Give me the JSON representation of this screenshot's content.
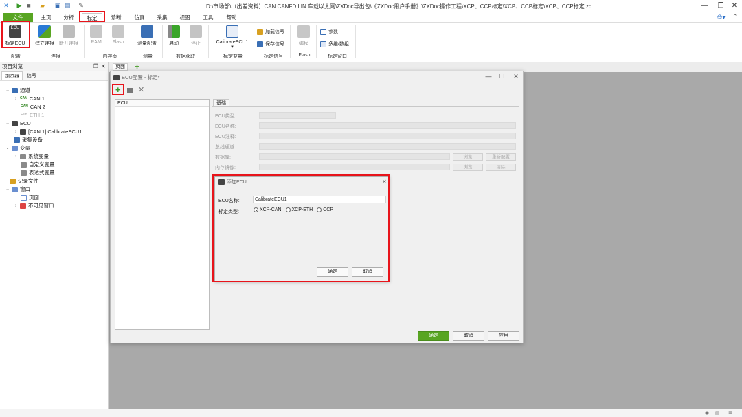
{
  "titlebar": {
    "path": "D:\\市场部\\（出差资料）CAN CANFD LIN 车载以太网\\ZXDoc导出包\\《ZXDoc用户手册》\\ZXDoc操作工程\\XCP、CCP标定\\XCP、CCP标定\\XCP、CCP标定.zcp* - ZXDoc"
  },
  "menu": {
    "items": [
      "文件",
      "主页",
      "分析",
      "标定",
      "诊断",
      "仿真",
      "采集",
      "视图",
      "工具",
      "帮助"
    ],
    "active": "标定"
  },
  "ribbon": {
    "groups": [
      "配置",
      "连接",
      "内存页",
      "测量",
      "数据获取",
      "标定变量",
      "标定信号",
      "Flash",
      "标定窗口"
    ],
    "buttons": {
      "calibrate_ecu": "标定ECU",
      "connect": "建立连接",
      "disconnect": "断开连接",
      "ram": "RAM",
      "flash": "Flash",
      "measure_config": "测量配置",
      "start": "启动",
      "stop": "停止",
      "calib_ecu1": "CalibrateECU1",
      "load_signal": "加载信号",
      "save_signal": "保存信号",
      "program": "编程",
      "param": "参数",
      "multi_data": "多维/数组"
    }
  },
  "left_panel": {
    "title": "项目浏览",
    "tabs": [
      "浏览器",
      "信号"
    ],
    "tree": {
      "channel": "通道",
      "can1": "CAN 1",
      "can2": "CAN 2",
      "eth1": "ETH 1",
      "can_badge": "CAN",
      "eth_badge": "ETH",
      "ecu": "ECU",
      "ecu_item": "[CAN 1] CalibrateECU1",
      "collect": "采集设备",
      "var": "变量",
      "sysvar": "系统变量",
      "custvar": "自定义变量",
      "exprvar": "表达式变量",
      "record": "记录文件",
      "window": "窗口",
      "page": "页面",
      "invisible": "不可见窗口"
    }
  },
  "workarea": {
    "doc_tab": "页面"
  },
  "ecu_config": {
    "title": "ECU配置 - 标定*",
    "list_header": "ECU",
    "tab_basic": "基础",
    "fields": {
      "ecu_type": "ECU类型:",
      "ecu_name": "ECU名称:",
      "ecu_note": "ECU注释:",
      "bus_channel": "总线通道:",
      "database": "数据库:",
      "mem_image": "内存镜像:"
    },
    "buttons": {
      "browse": "浏览",
      "reconfig": "重新配置",
      "browse2": "浏览",
      "clear": "清除",
      "ok": "确定",
      "cancel": "取消",
      "apply": "应用"
    }
  },
  "add_ecu": {
    "title": "添加ECU",
    "name_label": "ECU名称:",
    "name_value": "CalibrateECU1",
    "type_label": "标定类型:",
    "types": [
      "XCP-CAN",
      "XCP-ETH",
      "CCP"
    ],
    "selected": "XCP-CAN",
    "ok": "确定",
    "cancel": "取消"
  },
  "colors": {
    "accent": "#58a522",
    "highlight": "#e8141b"
  }
}
